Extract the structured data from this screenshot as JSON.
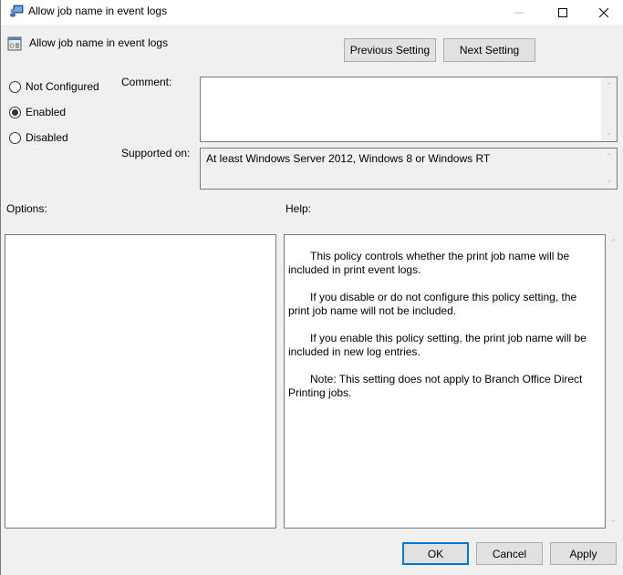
{
  "window": {
    "title": "Allow job name in event logs",
    "controls": {
      "minimize": "minimize-icon",
      "maximize": "maximize-icon",
      "close": "close-icon"
    }
  },
  "header": {
    "policy_name": "Allow job name in event logs",
    "previous_label": "Previous Setting",
    "next_label": "Next Setting"
  },
  "state": {
    "options": [
      {
        "label": "Not Configured",
        "checked": false
      },
      {
        "label": "Enabled",
        "checked": true
      },
      {
        "label": "Disabled",
        "checked": false
      }
    ]
  },
  "comment": {
    "label": "Comment:",
    "value": ""
  },
  "supported": {
    "label": "Supported on:",
    "value": "At least Windows Server 2012, Windows 8 or Windows RT"
  },
  "options_panel": {
    "label": "Options:"
  },
  "help_panel": {
    "label": "Help:",
    "paragraphs": [
      "This policy controls whether the print job name will be included in print event logs.",
      "If you disable or do not configure this policy setting, the print job name will not be included.",
      "If you enable this policy setting, the print job name will be included in new log entries.",
      "Note: This setting does not apply to Branch Office Direct Printing jobs."
    ]
  },
  "footer": {
    "ok_label": "OK",
    "cancel_label": "Cancel",
    "apply_label": "Apply"
  },
  "colors": {
    "accent": "#0078d7",
    "background": "#f0f0f0"
  }
}
